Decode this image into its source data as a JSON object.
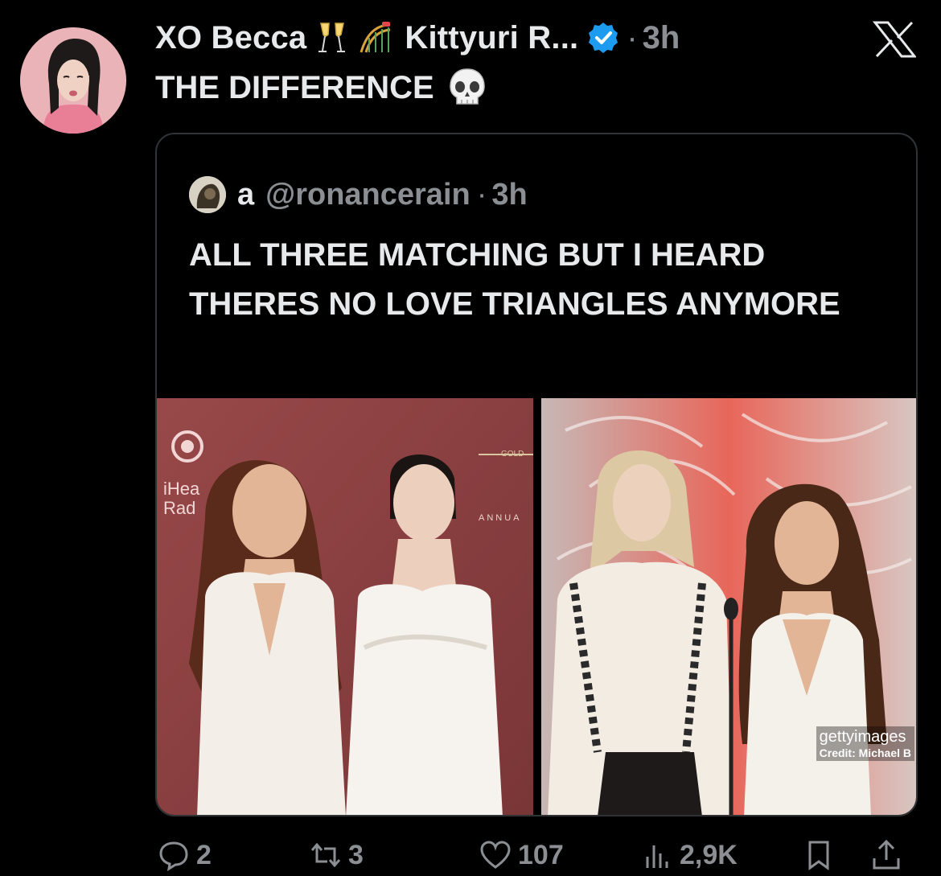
{
  "tweet": {
    "display_name": "XO Becca",
    "name_emojis": [
      "clinking-glasses-emoji",
      "roller-coaster-emoji"
    ],
    "retweeted_by": "Kittyuri R...",
    "separator": "·",
    "time": "3h",
    "text": "THE DIFFERENCE",
    "text_emoji": "skull-emoji"
  },
  "quote": {
    "name": "a",
    "handle": "@ronancerain",
    "separator": "·",
    "time": "3h",
    "text": "ALL THREE MATCHING BUT I HEARD THERES NO LOVE TRIANGLES ANYMORE",
    "media": {
      "left_photo_signage": [
        "iHea",
        "Rad",
        "GOLD",
        "ANNUA"
      ],
      "watermark": "gettyimages",
      "watermark_prefix": "getty",
      "watermark_suffix": "images",
      "credit": "Credit: Michael B"
    }
  },
  "actions": {
    "replies": "2",
    "retweets": "3",
    "likes": "107",
    "views": "2,9K"
  },
  "colors": {
    "background": "#000000",
    "text": "#e7e9ea",
    "muted": "#8b8f94",
    "verified": "#1d9bf0",
    "border": "#2f3336"
  }
}
